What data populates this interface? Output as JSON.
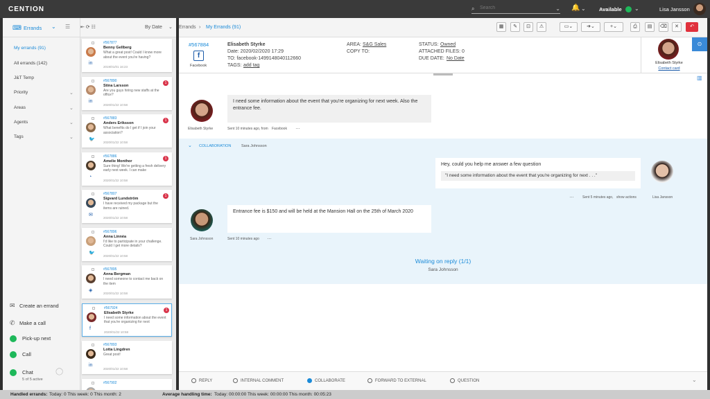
{
  "app": {
    "logo": "CENTION"
  },
  "topbar": {
    "search_placeholder": "Search",
    "status": "Available",
    "user": "Lisa Jansson"
  },
  "colors": {
    "accent": "#1a8ad8",
    "available": "#1eb85a",
    "badge": "#d9344a"
  },
  "nav": {
    "title": "Errands",
    "items": [
      "My errands (91)",
      "All errands (142)",
      "J&T Temp",
      "Priority",
      "Areas",
      "Agents",
      "Tags"
    ],
    "actions": {
      "create": "Create an errand",
      "call": "Make a call",
      "pickup": "Pick-up next",
      "call_toggle": "Call",
      "chat": "Chat",
      "chat_sub": "5 of 5 active"
    }
  },
  "list": {
    "sort": "By Date",
    "cards": [
      {
        "id": "#567877",
        "name": "Benny Gellberg",
        "preview": "What a great post! Could I know more about the event you're having?",
        "date": "2019/01/01 16:23",
        "badge": "",
        "channel": "in"
      },
      {
        "id": "#567890",
        "name": "Stina Larsson",
        "preview": "Are you guys hiring new staffs at the office?",
        "date": "2020/01/22 10:58",
        "badge": "1",
        "channel": "in"
      },
      {
        "id": "#567883",
        "name": "Anders Eriksson",
        "preview": "What benefits do I get if I join your association?",
        "date": "2020/01/22 10:58",
        "badge": "1",
        "channel": "tw"
      },
      {
        "id": "#567886",
        "name": "Amelie Monthor",
        "preview": "Sure thing! We're getting a fresh delivery early next week. I can make",
        "date": "2020/01/22 10:58",
        "badge": "1",
        "channel": "wa"
      },
      {
        "id": "#567807",
        "name": "Sigvard Lundström",
        "preview": "I have received my package but the items are ruined.",
        "date": "2020/01/22 10:58",
        "badge": "1",
        "channel": "em"
      },
      {
        "id": "#567896",
        "name": "Anna Linnéa",
        "preview": "I'd like to participate in your challenge. Could I get more details?",
        "date": "2020/01/22 10:58",
        "badge": "",
        "channel": "tw"
      },
      {
        "id": "#567895",
        "name": "Anna Bergman",
        "preview": "I need someone to contact me back on the item",
        "date": "2020/01/22 10:58",
        "badge": "",
        "channel": "ms"
      },
      {
        "id": "#567924",
        "name": "Elisabeth Styrke",
        "preview": "I need some information about the event that you're organizing for next",
        "date": "2020/01/22 10:58",
        "badge": "1",
        "channel": "fb"
      },
      {
        "id": "#567893",
        "name": "Lotta Lingdren",
        "preview": "Great post!",
        "date": "2020/01/22 10:58",
        "badge": "",
        "channel": "in"
      },
      {
        "id": "#567902",
        "name": "",
        "preview": "",
        "date": "",
        "badge": "",
        "channel": ""
      }
    ]
  },
  "breadcrumb": {
    "root": "Errands",
    "current": "My Errands (91)"
  },
  "errand": {
    "id": "#567884",
    "channel": "Facebook",
    "from": "Elisabeth Styrke",
    "date": "Date: 2020/02/2020 17:29",
    "to": "TO: facebook-1499148040112660",
    "tags_label": "TAGS:",
    "tags_link": "add tag",
    "area_label": "AREA:",
    "area": "S&G Sales",
    "copy": "COPY TO:",
    "status_label": "STATUS:",
    "status": "Owned",
    "attached": "ATTACHED FILES: 0",
    "due_label": "DUE DATE:",
    "due": "No Date",
    "contact_name": "Elisabeth Styrke",
    "contact_link": "Contact card"
  },
  "thread": {
    "msg1": "I need some information about the event that you're organizing for next week. Also the entrance fee.",
    "msg1_name": "Elisabeth Styrke",
    "msg1_meta": "Sent 10 minutes ago, from",
    "msg1_src": "Facebook",
    "collab_label": "COLLABORATION",
    "collab_with": "Sara Johnsson",
    "msg2": "Hey, could you help me answer a few question",
    "msg2_quote": "\"I need some information about the event that you're organizing for next . . .\"",
    "msg2_meta": "Sent 5 minutes ago,",
    "msg2_link": "show actions",
    "msg2_name": "Lisa Jansson",
    "msg3": "Entrance fee is $150 and will be held at the Mansion Hall on the 25th of March 2020",
    "msg3_name": "Sara Johnsson",
    "msg3_meta": "Sent 10 minutes ago",
    "waiting": "Waiting on reply (1/1)",
    "waiting_name": "Sara Johnsson"
  },
  "reply": {
    "options": [
      "REPLY",
      "INTERNAL COMMENT",
      "COLLABORATE",
      "FORWARD TO EXTERNAL",
      "QUESTION"
    ]
  },
  "statusbar": {
    "handled": "Handled errands:",
    "handled_vals": "Today: 0  This week: 0  This month: 2",
    "aht": "Average handling time:",
    "aht_vals": "Today: 00:00:00  This week: 00:00:00  This month: 00:05:23"
  }
}
